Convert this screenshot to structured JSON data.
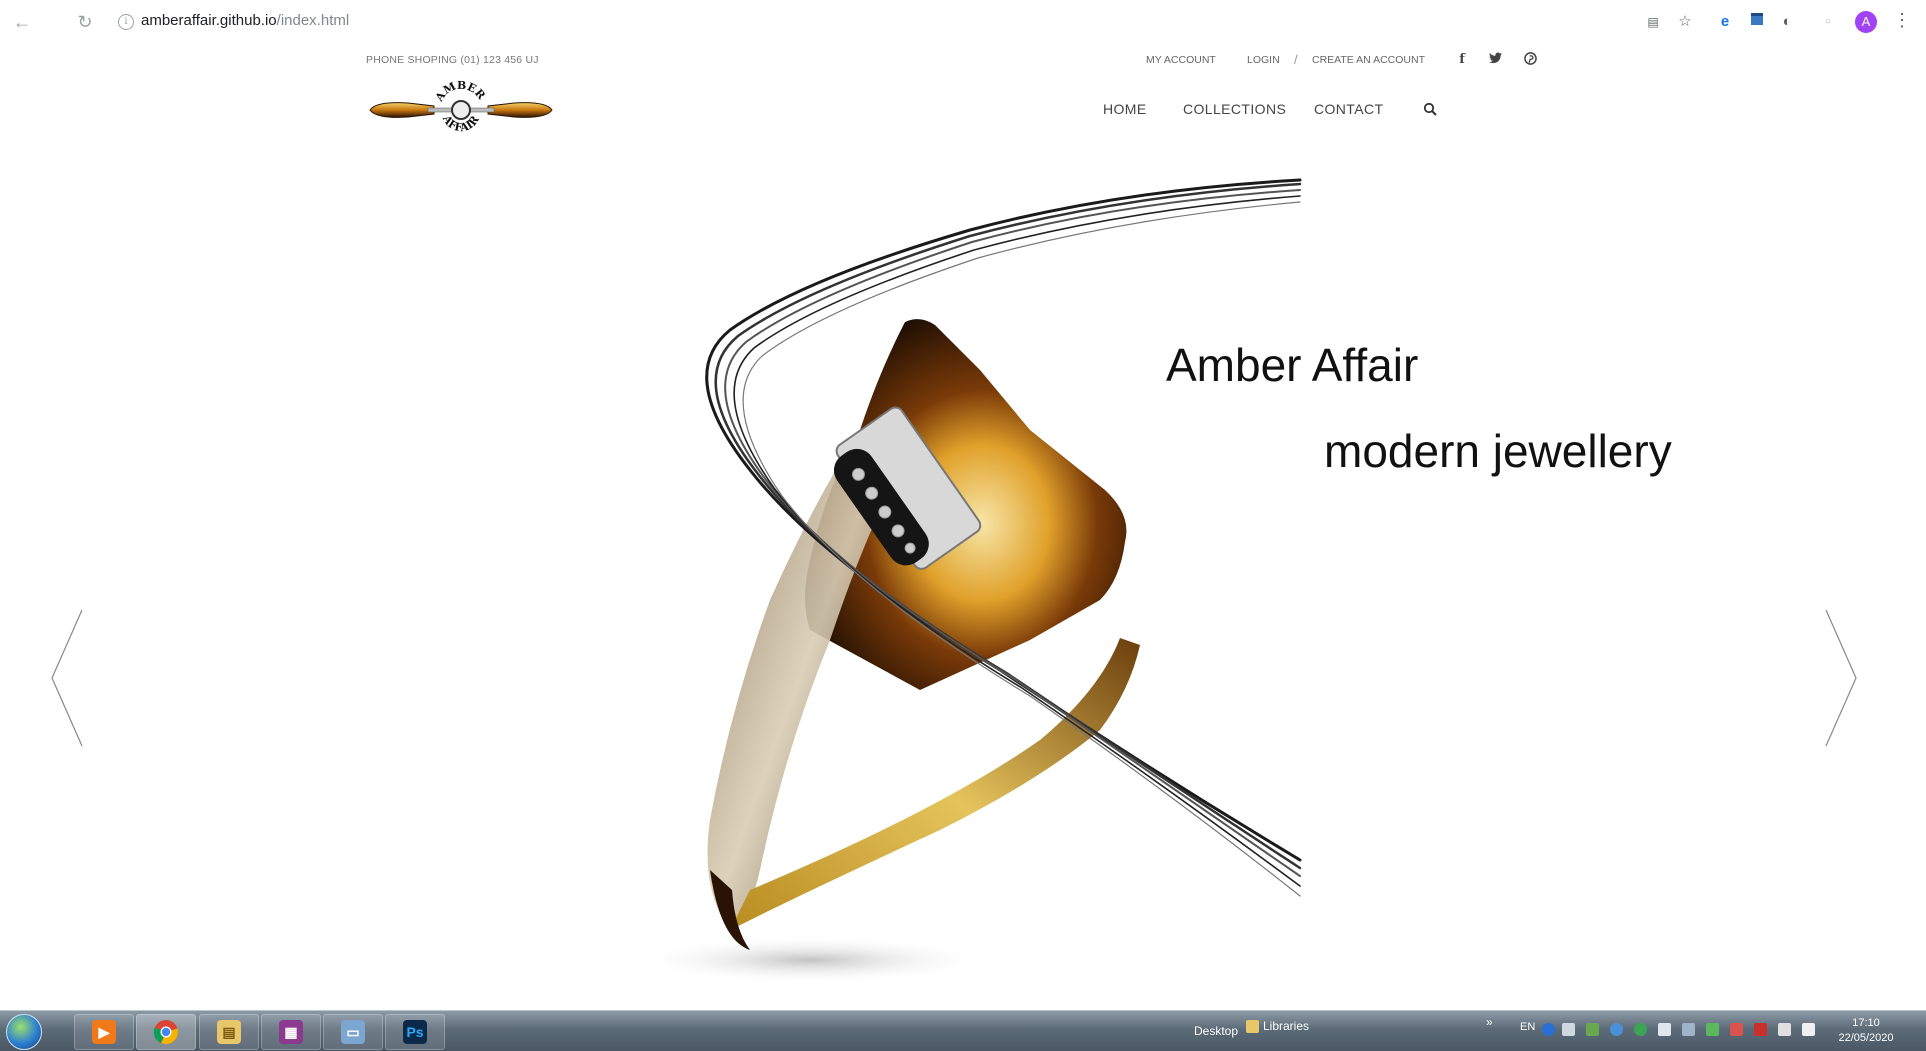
{
  "browser": {
    "back_icon": "arrow-left-icon",
    "reload_icon": "reload-icon",
    "url_host": "amberaffair.github.io",
    "url_path": "/index.html",
    "avatar_letter": "A"
  },
  "header": {
    "phone": "PHONE SHOPING (01) 123 456 UJ",
    "links": {
      "my_account": "MY ACCOUNT",
      "login": "LOGIN",
      "separator": "/",
      "create_account": "CREATE AN ACCOUNT"
    },
    "social": [
      "facebook-icon",
      "twitter-icon",
      "pinterest-icon"
    ],
    "logo_text": "AMBER AFFAIR",
    "nav": [
      "HOME",
      "COLLECTIONS",
      "CONTACT"
    ]
  },
  "hero": {
    "title": "Amber Affair",
    "subtitle": "modern jewellery"
  },
  "taskbar": {
    "desktop_label": "Desktop",
    "libraries_label": "Libraries",
    "chevron": "»",
    "language": "EN",
    "time": "17:10",
    "date": "22/05/2020",
    "apps": [
      "media-player-icon",
      "chrome-icon",
      "file-explorer-icon",
      "winrar-icon",
      "scanner-icon",
      "photoshop-icon"
    ],
    "photoshop_label": "Ps"
  },
  "colors": {
    "amber_dark": "#2a1305",
    "amber_mid": "#c9780f",
    "amber_light": "#f3d36a",
    "avatar": "#a142f4"
  }
}
